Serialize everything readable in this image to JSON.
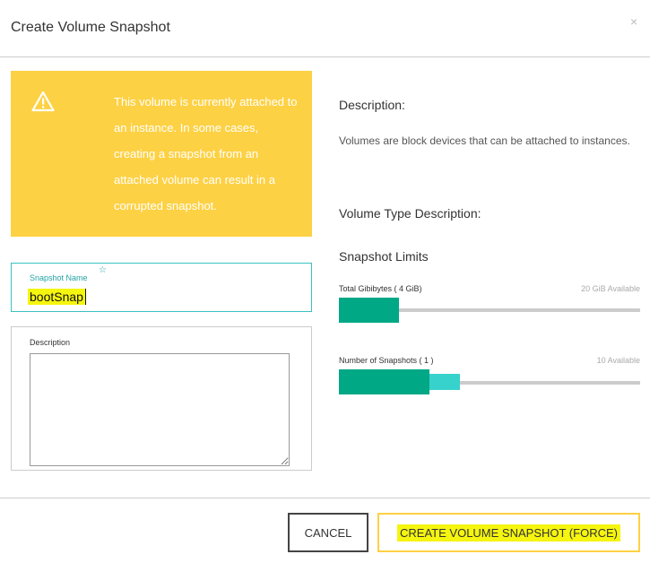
{
  "modal": {
    "title": "Create Volume Snapshot",
    "close_glyph": "×"
  },
  "warning": {
    "icon": "warning-triangle-icon",
    "text": "This volume is currently attached to an instance. In some cases, creating a snapshot from an attached volume can result in a corrupted snapshot."
  },
  "form": {
    "snapshot_name": {
      "label": "Snapshot Name",
      "required_glyph": "☆",
      "value": "bootSnap"
    },
    "description": {
      "label": "Description",
      "value": ""
    }
  },
  "info": {
    "description_title": "Description:",
    "description_body": "Volumes are block devices that can be attached to instances.",
    "volume_type_title": "Volume Type Description:",
    "limits_title": "Snapshot Limits"
  },
  "limits": {
    "gibibytes": {
      "label": "Total Gibibytes ( 4 GiB)",
      "available": "20 GiB Available",
      "used_fraction": 0.2
    },
    "snapshots": {
      "label": "Number of Snapshots ( 1 )",
      "available": "10 Available",
      "used_fraction": 0.3,
      "adding_fraction": 0.1
    }
  },
  "footer": {
    "cancel_label": "CANCEL",
    "create_label": "CREATE VOLUME SNAPSHOT (FORCE)"
  },
  "colors": {
    "warning_bg": "#fdd144",
    "accent_teal": "#3bc1c1",
    "quota_used": "#00a886",
    "quota_adding": "#38d2cc",
    "highlight": "#f5f50f"
  }
}
